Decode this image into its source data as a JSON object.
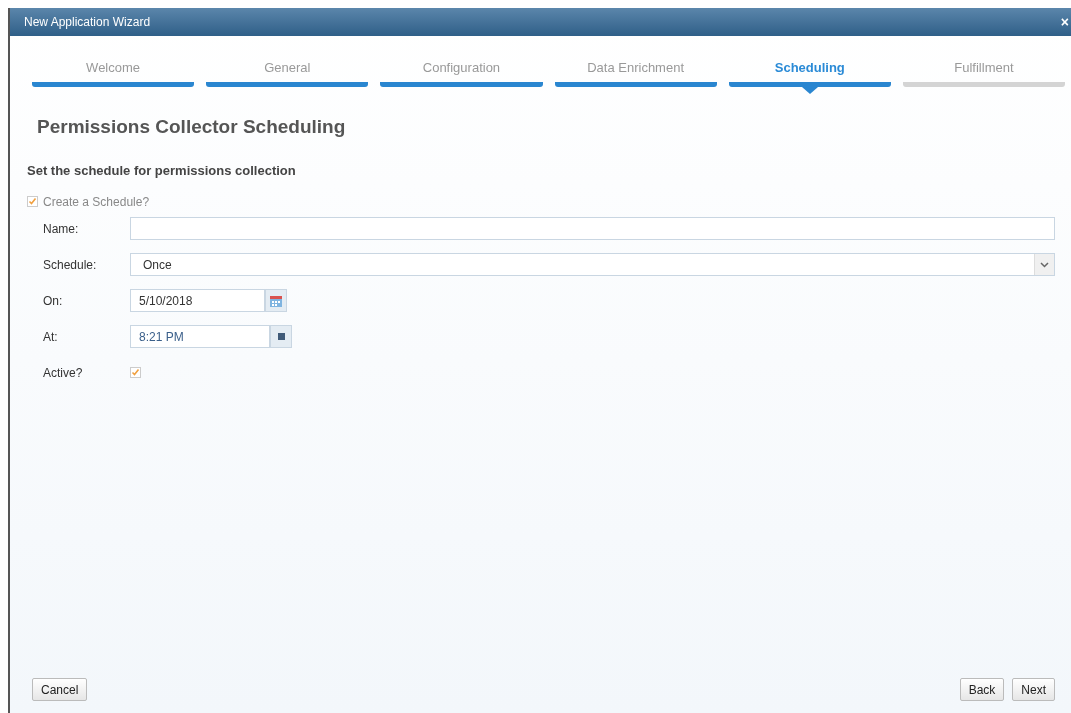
{
  "window": {
    "title": "New Application Wizard",
    "close": "×"
  },
  "steps": [
    {
      "label": "Welcome",
      "completed": true,
      "selected": false
    },
    {
      "label": "General",
      "completed": true,
      "selected": false
    },
    {
      "label": "Configuration",
      "completed": true,
      "selected": false
    },
    {
      "label": "Data Enrichment",
      "completed": true,
      "selected": false
    },
    {
      "label": "Scheduling",
      "completed": false,
      "selected": true
    },
    {
      "label": "Fulfillment",
      "completed": false,
      "selected": false
    }
  ],
  "heading": "Permissions Collector Scheduling",
  "subheading": "Set the schedule for permissions collection",
  "create_schedule": {
    "label": "Create a Schedule?",
    "checked": true
  },
  "fields": [
    {
      "kind": "text",
      "label": "Name:"
    },
    {
      "kind": "select",
      "label": "Schedule:",
      "value": "Once"
    },
    {
      "kind": "date",
      "label": "On:",
      "value": "5/10/2018"
    },
    {
      "kind": "time",
      "label": "At:",
      "value": "8:21 PM"
    },
    {
      "kind": "checkbox",
      "label": "Active?",
      "checked": true
    }
  ],
  "buttons": {
    "left": [
      "Cancel"
    ],
    "right": [
      "Back",
      "Next"
    ]
  }
}
